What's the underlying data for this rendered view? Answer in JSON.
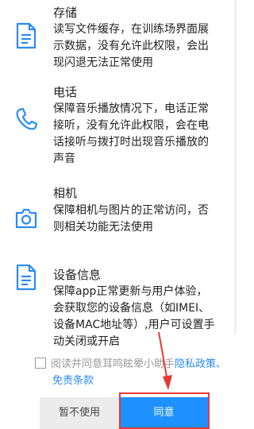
{
  "permissions": [
    {
      "icon": "document-icon",
      "title": "存储",
      "lines": [
        "读写文件缓存，在训练场界面展",
        "示数据，没有允许此权限，会出",
        "现闪退无法正常使用"
      ]
    },
    {
      "icon": "phone-icon",
      "title": "电话",
      "lines": [
        "保障音乐播放情况下，电话正常",
        "接听，没有允许此权限，会在电",
        "话接听与拨打时出现音乐播放的",
        "声音"
      ]
    },
    {
      "icon": "camera-icon",
      "title": "相机",
      "lines": [
        "保障相机与图片的正常访问，否",
        "则相关功能无法使用"
      ]
    },
    {
      "icon": "document-icon",
      "title": "设备信息",
      "lines": [
        "保障app正常更新与用户体验，",
        "会获取您的设备信息（如IMEI、",
        "设备MAC地址等）,用户可设置手",
        "动关闭或开启"
      ]
    }
  ],
  "agreement": {
    "prefix": "阅读并同意耳鸣眩晕小助手",
    "privacy_link": "隐私政策",
    "separator": "、",
    "terms_link": "免责条款",
    "checked": false
  },
  "buttons": {
    "cancel_label": "暂不使用",
    "agree_label": "同意"
  },
  "colors": {
    "accent": "#1e90ff",
    "link": "#2a8cf0",
    "highlight": "#e53935",
    "icon": "#2a8cf0"
  }
}
